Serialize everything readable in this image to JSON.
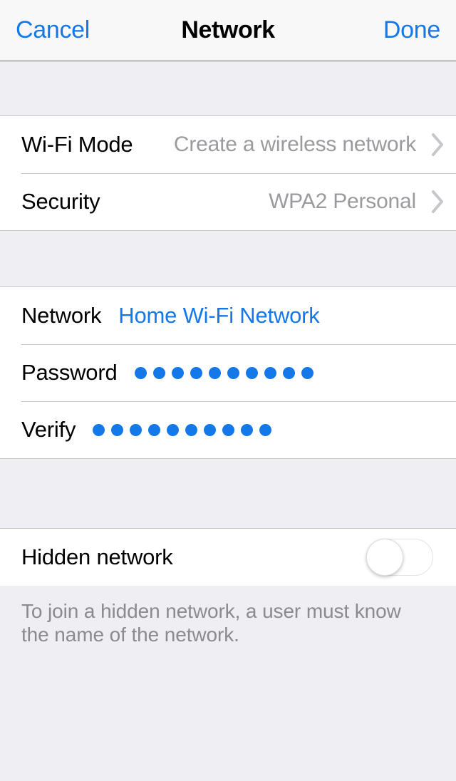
{
  "navbar": {
    "cancel_label": "Cancel",
    "title": "Network",
    "done_label": "Done"
  },
  "colors": {
    "accent_blue": "#1478E8",
    "group_background": "#FFFFFF",
    "page_background": "#EFEEF3",
    "separator": "#C8C7CC",
    "value_gray": "#9A9A9F",
    "footer_gray": "#8A8A8F"
  },
  "sections": [
    {
      "name": "wireless-configuration",
      "rows": [
        {
          "label": "Wi-Fi Mode",
          "value": "Create a wireless network",
          "accessory": "chevron-right-icon"
        },
        {
          "label": "Security",
          "value": "WPA2 Personal",
          "accessory": "chevron-right-icon"
        }
      ]
    },
    {
      "name": "network-credentials",
      "rows": [
        {
          "label": "Network",
          "value": "Home Wi-Fi Network",
          "value_style": "link"
        },
        {
          "label": "Password",
          "value": "••••••••••",
          "masked": true,
          "dot_count": 10
        },
        {
          "label": "Verify",
          "value": "••••••••••",
          "masked": true,
          "dot_count": 10
        }
      ]
    },
    {
      "name": "hidden-network",
      "rows": [
        {
          "label": "Hidden network",
          "control": "toggle-switch",
          "toggle_state": "off"
        }
      ]
    }
  ],
  "footer": {
    "note": "To join a hidden network, a user must know the name of the network."
  }
}
